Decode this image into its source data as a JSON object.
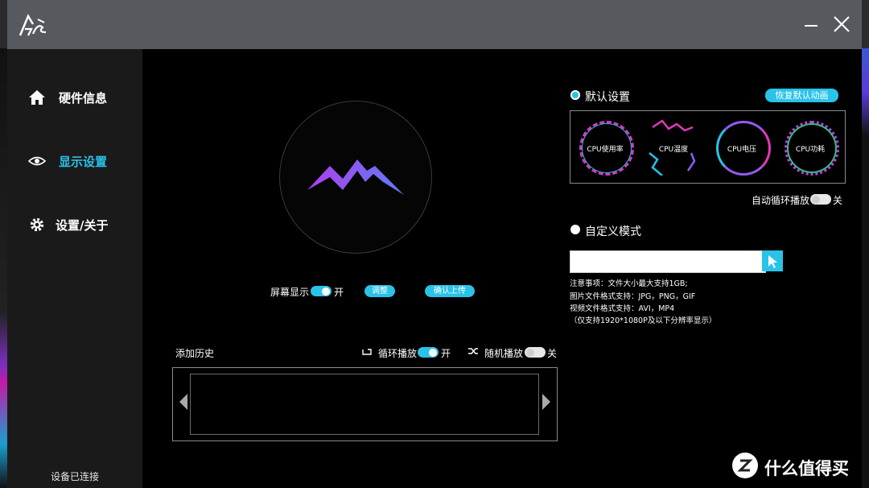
{
  "titlebar": {
    "logo": "app-logo",
    "minimize_icon": "minimize-icon",
    "close_icon": "close-icon"
  },
  "sidebar": {
    "items": [
      {
        "label": "硬件信息",
        "icon": "home-icon"
      },
      {
        "label": "显示设置",
        "icon": "eye-icon",
        "active": true
      },
      {
        "label": "设置/关于",
        "icon": "gear-icon"
      }
    ],
    "status": "设备已连接"
  },
  "screen": {
    "display_label": "屏幕显示",
    "display_state": "开",
    "adjust_label": "调整",
    "upload_label": "确认上传"
  },
  "history": {
    "title": "添加历史",
    "loop_label": "循环播放",
    "loop_state": "开",
    "shuffle_label": "随机播放",
    "shuffle_state": "关"
  },
  "default_mode": {
    "label": "默认设置",
    "restore_label": "恢复默认动画",
    "animations": [
      "CPU使用率",
      "CPU温度",
      "CPU电压",
      "CPU功耗"
    ],
    "auto_loop_label": "自动循环播放",
    "auto_loop_state": "关"
  },
  "custom_mode": {
    "label": "自定义模式",
    "file_value": "",
    "notes": [
      "注意事项：文件大小最大支持1GB;",
      "图片文件格式支持：JPG，PNG，GIF",
      "视频文件格式支持：AVI，MP4",
      "（仅支持1920*1080P及以下分辨率显示）"
    ]
  },
  "watermark": {
    "text": "什么值得买",
    "icon": "zhi-icon"
  },
  "colors": {
    "accent": "#29c3e8",
    "titlebar": "#565a5e",
    "sidebar": "#1a1a1a"
  }
}
